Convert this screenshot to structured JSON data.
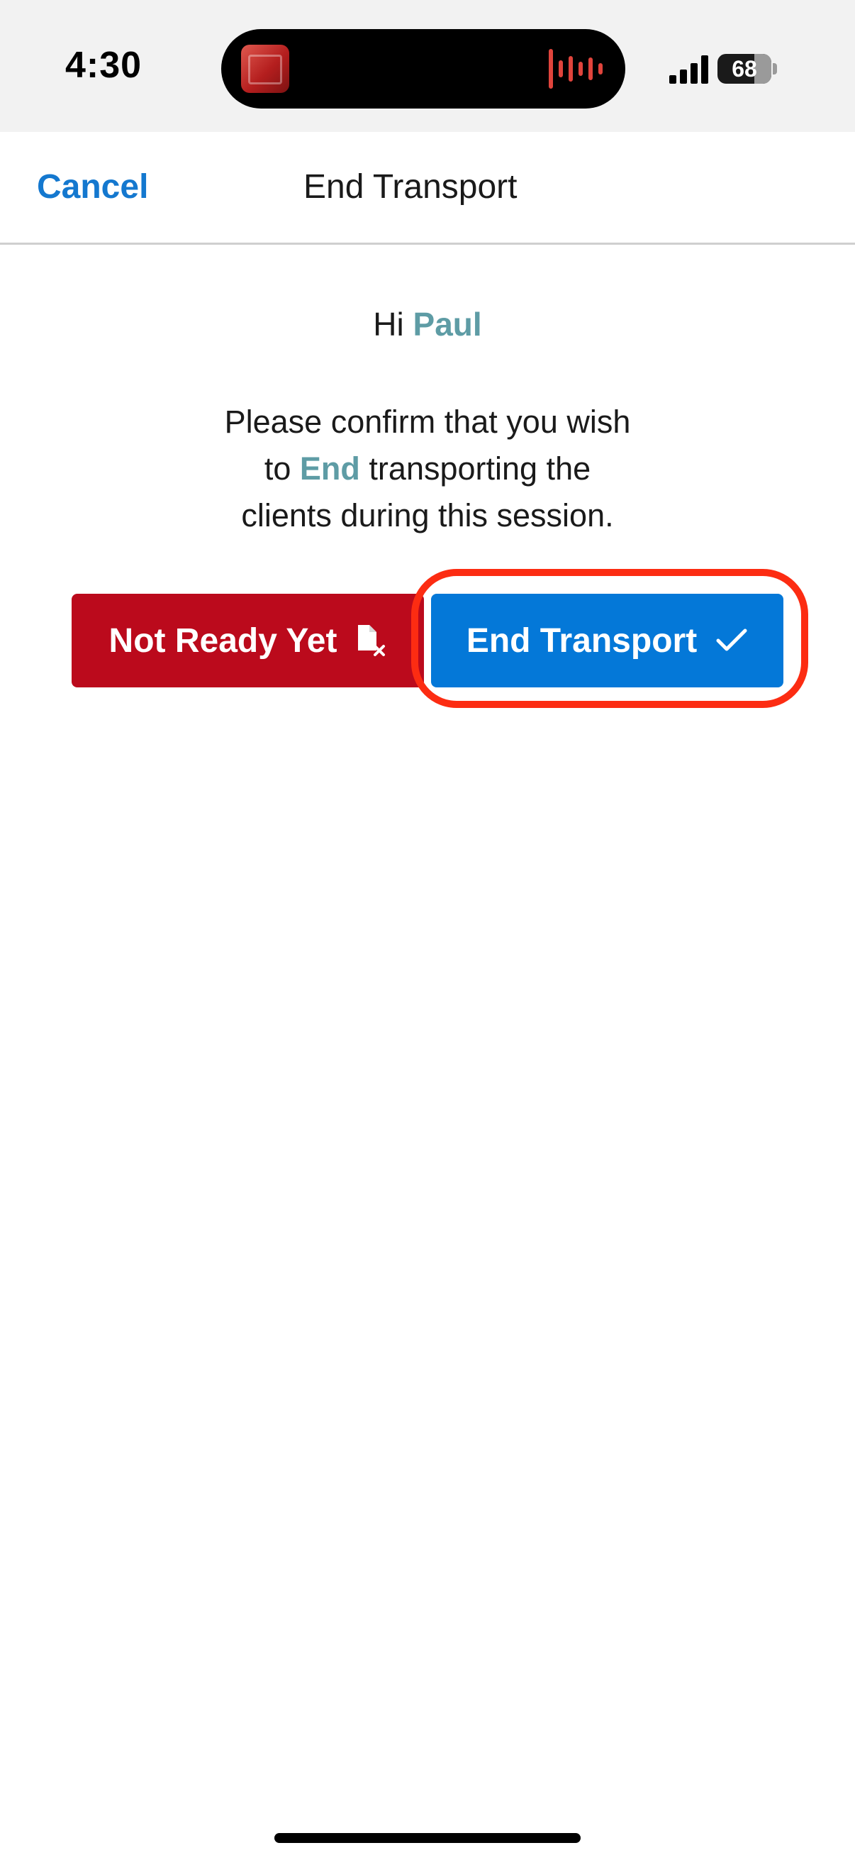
{
  "status_bar": {
    "time": "4:30",
    "battery_level": "68"
  },
  "nav": {
    "cancel_label": "Cancel",
    "title": "End Transport"
  },
  "greeting": {
    "prefix": "Hi ",
    "name": "Paul"
  },
  "message": {
    "line1": "Please confirm that you wish",
    "line2_prefix": "to ",
    "line2_highlight": "End",
    "line2_suffix": " transporting the",
    "line3": "clients during this session."
  },
  "buttons": {
    "not_ready_label": "Not Ready Yet",
    "not_ready_icon": "file-x-icon",
    "end_label": "End Transport",
    "end_icon": "checkmark-icon"
  },
  "colors": {
    "accent_blue": "#1478cf",
    "highlight_teal": "#5e9ca5",
    "danger_red": "#bb0a1c",
    "primary_blue": "#0478d8",
    "annotation_ring": "#fc2c12"
  }
}
